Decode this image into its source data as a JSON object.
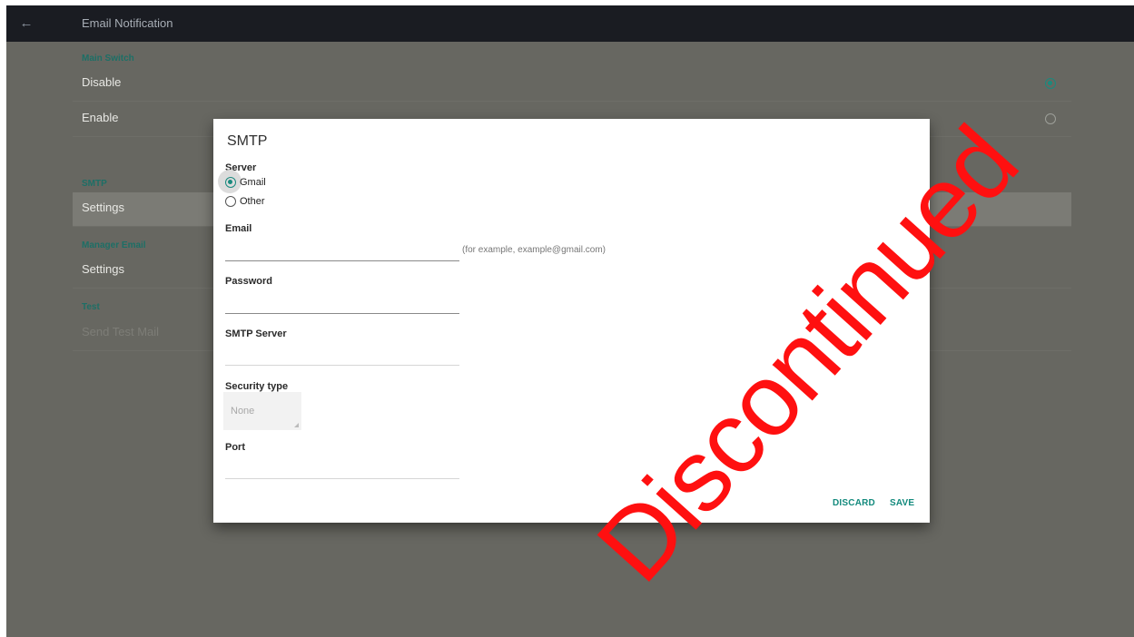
{
  "appbar": {
    "title": "Email Notification",
    "back_icon": "arrow-left-icon"
  },
  "settings": {
    "main_switch": {
      "section_label": "Main Switch",
      "options": [
        {
          "label": "Disable",
          "selected": true
        },
        {
          "label": "Enable",
          "selected": false
        }
      ]
    },
    "smtp": {
      "section_label": "SMTP",
      "item_label": "Settings"
    },
    "manager_email": {
      "section_label": "Manager Email",
      "item_label": "Settings"
    },
    "test": {
      "section_label": "Test",
      "item_label": "Send Test Mail"
    }
  },
  "dialog": {
    "title": "SMTP",
    "server": {
      "label": "Server",
      "options": [
        {
          "label": "Gmail",
          "selected": true
        },
        {
          "label": "Other",
          "selected": false
        }
      ]
    },
    "email": {
      "label": "Email",
      "value": "",
      "hint": "(for example, example@gmail.com)"
    },
    "password": {
      "label": "Password",
      "value": ""
    },
    "smtp_server": {
      "label": "SMTP Server",
      "value": ""
    },
    "security_type": {
      "label": "Security type",
      "value": "None"
    },
    "port": {
      "label": "Port",
      "value": ""
    },
    "buttons": {
      "discard": "DISCARD",
      "save": "SAVE"
    }
  },
  "watermark": {
    "text": "Discontinued"
  },
  "colors": {
    "accent": "#1a8a7e",
    "appbar": "#1a1c22",
    "scrim": "#676761",
    "watermark": "#ff1010"
  }
}
